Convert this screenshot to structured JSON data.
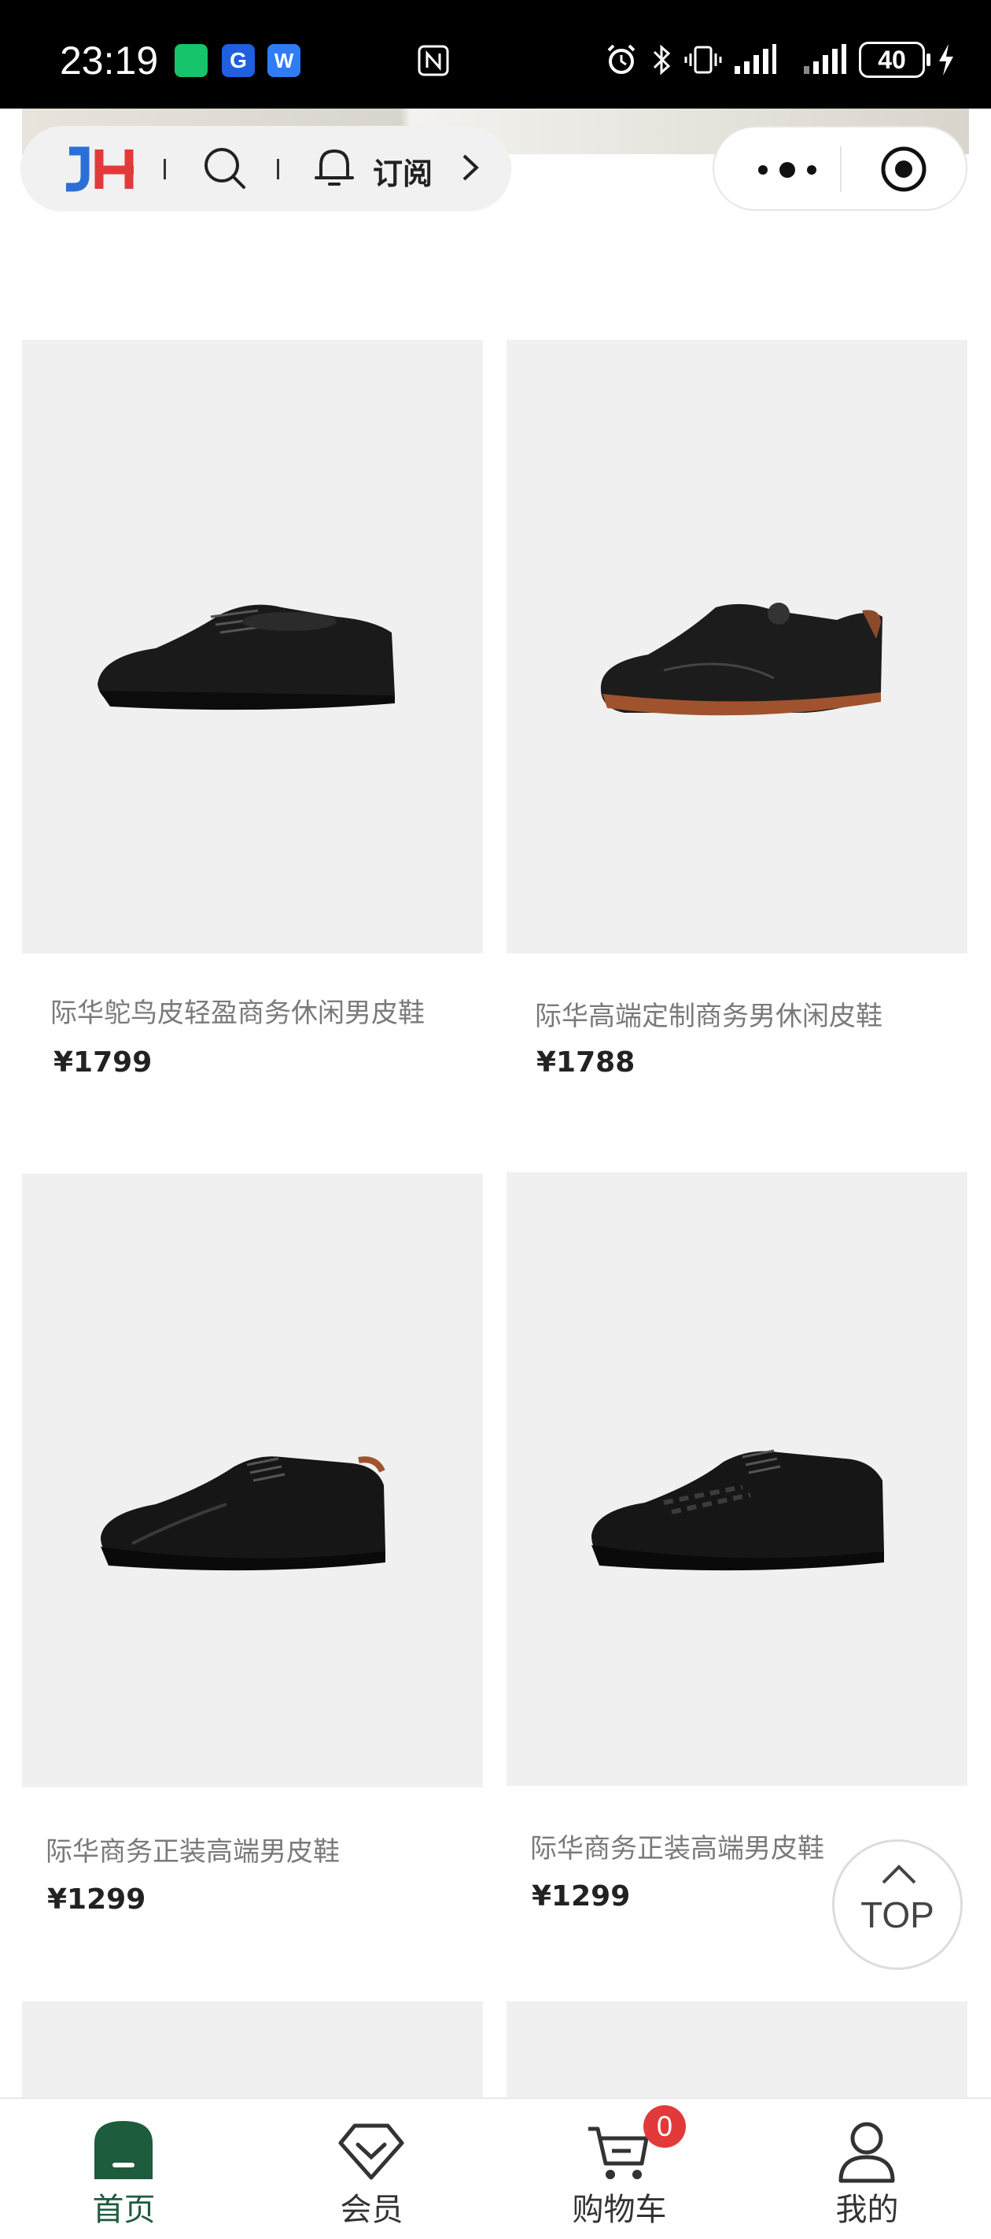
{
  "status_bar": {
    "time": "23:19",
    "battery": "40",
    "icons": [
      "app-notification-icon",
      "nfc-icon",
      "alarm-icon",
      "bluetooth-icon",
      "vibrate-icon",
      "signal-icon",
      "signal-icon",
      "battery-icon",
      "charging-icon"
    ]
  },
  "header": {
    "logo_text": "JH",
    "subscribe_label": "订阅",
    "icons": [
      "search-icon",
      "bell-icon",
      "chevron-right-icon",
      "more-icon",
      "close-icon"
    ]
  },
  "products": [
    {
      "name": "际华鸵鸟皮轻盈商务休闲男皮鞋",
      "price": "¥1799"
    },
    {
      "name": "际华高端定制商务男休闲皮鞋",
      "price": "¥1788"
    },
    {
      "name": "际华商务正装高端男皮鞋",
      "price": "¥1299"
    },
    {
      "name": "际华商务正装高端男皮鞋",
      "price": "¥1299"
    }
  ],
  "top_button": {
    "label": "TOP"
  },
  "tab_bar": {
    "items": [
      {
        "label": "首页",
        "icon": "home-icon",
        "active": true
      },
      {
        "label": "会员",
        "icon": "diamond-icon",
        "active": false
      },
      {
        "label": "购物车",
        "icon": "cart-icon",
        "active": false,
        "badge": "0"
      },
      {
        "label": "我的",
        "icon": "user-icon",
        "active": false
      }
    ]
  },
  "colors": {
    "accent": "#1d5c3d",
    "badge": "#e23a3a",
    "card_bg": "#f0f0f0",
    "logo_blue": "#2b6fd6",
    "logo_red": "#e23a3a"
  }
}
